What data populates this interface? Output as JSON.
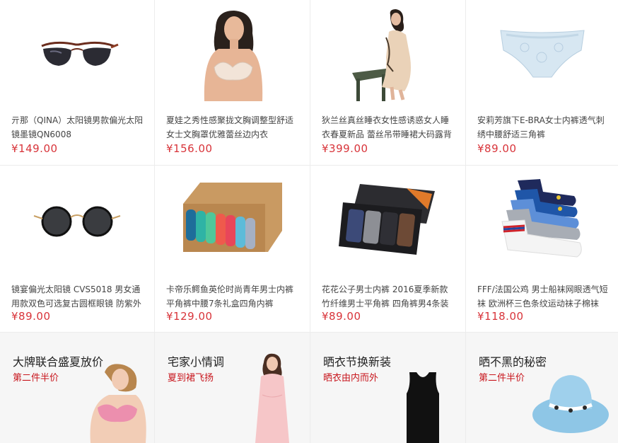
{
  "products": [
    {
      "name": "亓那（QINA）太阳镜男款偏光太阳镜墨镜QN6008",
      "price": "¥149.00",
      "icon": "sunglasses-icon"
    },
    {
      "name": "夏娃之秀性感聚拢文胸调整型舒适女士文胸罩优雅蕾丝边内衣",
      "price": "¥156.00",
      "icon": "bra-model-icon"
    },
    {
      "name": "狄兰丝真丝睡衣女性感诱惑女人睡衣春夏新品 蕾丝吊带睡裙大码露背",
      "price": "¥399.00",
      "icon": "nightgown-model-icon"
    },
    {
      "name": "安莉芳旗下E-BRA女士内裤透气刺绣中腰舒适三角裤",
      "price": "¥89.00",
      "icon": "panties-icon"
    },
    {
      "name": "镜宴偏光太阳镜 CVS5018 男女通用款双色可选复古圆框眼镜 防紫外",
      "price": "¥89.00",
      "icon": "round-sunglasses-icon"
    },
    {
      "name": "卡帝乐鳄鱼英伦时尚青年男士内裤平角裤中腰7条礼盒四角内裤",
      "price": "¥129.00",
      "icon": "underwear-box-icon"
    },
    {
      "name": "花花公子男士内裤 2016夏季新款 竹纤维男士平角裤 四角裤男4条装",
      "price": "¥89.00",
      "icon": "boxers-gift-box-icon"
    },
    {
      "name": "FFF/法国公鸡 男士船袜网眼透气短袜 欧洲杯三色条纹运动袜子棉袜",
      "price": "¥118.00",
      "icon": "socks-icon"
    }
  ],
  "promos": [
    {
      "title": "大牌联合盛夏放价",
      "sub": "第二件半价",
      "icon": "lingerie-model-icon"
    },
    {
      "title": "宅家小情调",
      "sub": "夏到裙飞扬",
      "icon": "pink-dress-model-icon"
    },
    {
      "title": "晒衣节换新装",
      "sub": "晒衣由内而外",
      "icon": "tank-top-icon"
    },
    {
      "title": "晒不黑的秘密",
      "sub": "第二件半价",
      "icon": "sun-hat-icon"
    }
  ],
  "colors": {
    "price": "#d8343a",
    "promo_sub": "#c8161d"
  }
}
